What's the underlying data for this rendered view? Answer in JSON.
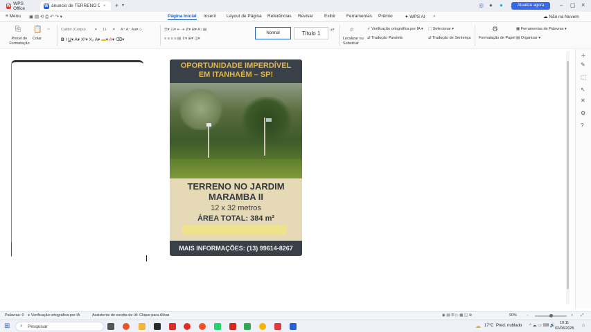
{
  "titlebar": {
    "app_tab": "WPS Office",
    "doc_tab": "anuncio de TERRENO DO J...",
    "upgrade_button": "Atualize agora"
  },
  "menu": {
    "menu_button": "Menu",
    "tabs": [
      "Página Inicial",
      "Inserir",
      "Layout de Página",
      "Referências",
      "Revisar",
      "Exibir",
      "Ferramentas",
      "Prêmio",
      "WPS AI"
    ],
    "active_tab": "Página Inicial",
    "user": "Não na Nuvem"
  },
  "ribbon": {
    "format_painter": "Pincel de Formatação",
    "paste": "Colar",
    "font_name": "Calibri (Corpo)",
    "font_size": "11",
    "style_normal": "Normal",
    "style_heading": "Título 1",
    "find": "Localizar ou Substituir",
    "spellcheck_ai": "Verificação ortográfica por IA",
    "select": "Selecionar",
    "trans_parallel": "Tradução Paralela",
    "trans_sentence": "Tradução de Sentença",
    "paper_format": "Formatação de Papel",
    "text_tools": "Ferramentas de Palavras",
    "organize": "Organizar"
  },
  "flyer": {
    "headline_1": "OPORTUNIDADE IMPERDÍVEL",
    "headline_2": "EM ITANHAÉM – SP!",
    "title_1": "TERRENO NO JARDIM",
    "title_2": "MARAMBA II",
    "size": "12 x 32 metros",
    "area": "ÁREA TOTAL: 384 m²",
    "footer": "MAIS INFORMAÇÕES: (13) 99614-8267"
  },
  "statusbar": {
    "pages": "Palavras: 0",
    "spellcheck": "Verificação ortográfica por IA",
    "assistant": "Assistente de escrita de IA: Clique para Ativar",
    "zoom": "90%"
  },
  "taskbar": {
    "search_placeholder": "Pesquisar",
    "weather_temp": "17°C",
    "weather_desc": "Pred. nublado",
    "time": "10:11",
    "date": "02/08/2025"
  },
  "colors": {
    "accent": "#1f5fd1",
    "flyer_dark": "#3a4047",
    "flyer_gold": "#e2b84a",
    "flyer_beige": "#e6d9b6"
  }
}
